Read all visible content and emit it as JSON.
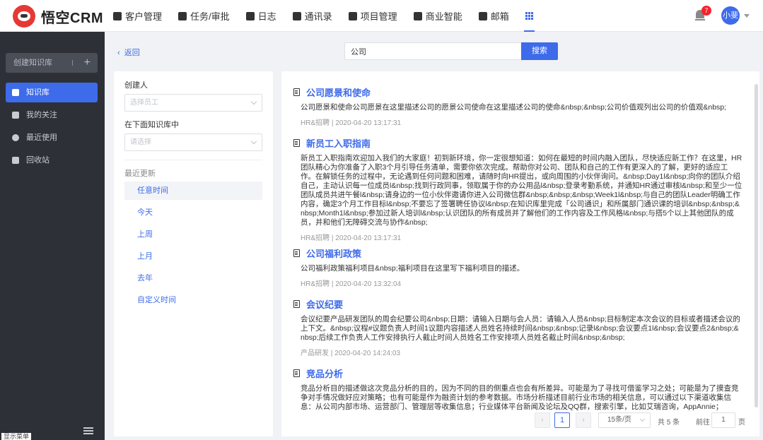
{
  "app": {
    "name": "悟空CRM"
  },
  "nav": {
    "items": [
      {
        "label": "客户管理",
        "icon": "customer-icon"
      },
      {
        "label": "任务/审批",
        "icon": "task-icon"
      },
      {
        "label": "日志",
        "icon": "log-icon"
      },
      {
        "label": "通讯录",
        "icon": "contacts-icon"
      },
      {
        "label": "项目管理",
        "icon": "project-icon"
      },
      {
        "label": "商业智能",
        "icon": "bi-icon"
      },
      {
        "label": "邮箱",
        "icon": "mail-icon"
      }
    ],
    "apps_icon": "apps-grid-icon"
  },
  "header": {
    "notification_count": "7",
    "user_name": "小斐"
  },
  "sidebar": {
    "create_label": "创建知识库",
    "items": [
      {
        "label": "知识库",
        "icon": "book-icon",
        "active": true
      },
      {
        "label": "我的关注",
        "icon": "star-icon"
      },
      {
        "label": "最近使用",
        "icon": "clock-icon"
      },
      {
        "label": "回收站",
        "icon": "trash-icon"
      }
    ],
    "footer_label": "显示菜单"
  },
  "toolbar": {
    "back_label": "返回",
    "search_value": "公司",
    "search_button": "搜索"
  },
  "filter": {
    "creator_label": "创建人",
    "creator_placeholder": "选择员工",
    "kb_label": "在下面知识库中",
    "kb_placeholder": "请选择",
    "recent_label": "最近更新",
    "times": [
      "任意时间",
      "今天",
      "上周",
      "上月",
      "去年",
      "自定义时间"
    ]
  },
  "articles": [
    {
      "title": "公司愿景和使命",
      "body": "公司愿景和使命公司愿景在这里描述公司的愿景公司使命在这里描述公司的使命&nbsp;&nbsp;公司价值观列出公司的价值观&nbsp;",
      "meta": "HR&招聘 | 2020-04-20 13:17:31"
    },
    {
      "title": "新员工入职指南",
      "body": "新员工入职指南欢迎加入我们的大家庭！初到新环境，你一定很想知道：如何在最短的时间内融入团队，尽快适应新工作？在这里，HR团队精心为你准备了入职3个月引导任务清单，需要你依次完成。帮助你对公司、团队和自己的工作有更深入的了解，更好的适应工作。在解锁任务的过程中，无论遇到任何问题和困难，请随时向HR提出，或向周围的小伙伴询问。&nbsp;Day1l&nbsp;向你的团队介绍自己，主动认识每一位成员l&nbsp;找到行政同事，领取属于你的办公用品l&nbsp;登录考勤系统，并通知HR通过审核l&nbsp;和至少一位团队成员共进午餐l&nbsp;请身边的一位小伙伴邀请你进入公司微信群&nbsp;&nbsp;&nbsp;Week1l&nbsp;与自己的团队Leader明确工作内容，确定3个月工作目标l&nbsp;不要忘了签署聘任协议l&nbsp;在知识库里完成「公司通识」和所属部门通识课的培训&nbsp;&nbsp;&nbsp;Month1l&nbsp;参加过新人培训l&nbsp;认识团队的所有成员并了解他们的工作内容及工作风格l&nbsp;与搭5个以上其他团队的成员，并和他们无障碍交流与协作&nbsp;",
      "meta": "HR&招聘 | 2020-04-20 13:17:31"
    },
    {
      "title": "公司福利政策",
      "body": "公司福利政策福利项目&nbsp;福利项目在这里写下福利项目的描述。",
      "meta": "HR&招聘 | 2020-04-20 13:32:04"
    },
    {
      "title": "会议纪要",
      "body": "会议纪要产品研发团队的周会纪要公司&nbsp;日期：请输入日期与会人员：请输入人员&nbsp;目标制定本次会议的目标或者描述会议的上下文。&nbsp;议程#议题负责人时间1议题内容描述人员姓名持续时间&nbsp;&nbsp;记录l&nbsp;会议要点1l&nbsp;会议要点2&nbsp;&nbsp;后续工作负责人工作安排执行人截止时间人员姓名工作安排项人员姓名截止时间&nbsp;&nbsp;",
      "meta": "产品研发 | 2020-04-20 14:24:03"
    },
    {
      "title": "竞品分析",
      "body": "竞品分析目的描述做这次竞品分析的目的，因为不同的目的侧重点也会有所差异。可能是为了寻找可借鉴学习之处；可能是为了摸查竞争对手情况做好应对策略；也有可能是作为融资计划的参考数据。市场分析描述目前行业市场的相关信息，可以通过以下渠道收集信息：从公司内部市场、运营部门、管理层等收集信息；行业媒体平台新闻及论坛及QQ群，搜索引擎，比如艾瑞咨询，AppAnnie；",
      "meta": ""
    }
  ],
  "pagination": {
    "current_page": "1",
    "page_size": "15条/页",
    "total_text": "共 5 条",
    "goto_label": "前往",
    "goto_value": "1",
    "page_suffix": "页"
  },
  "colors": {
    "accent": "#3e6bea",
    "sidebar_bg": "#2d3037",
    "page_bg": "#f0f2f5"
  }
}
